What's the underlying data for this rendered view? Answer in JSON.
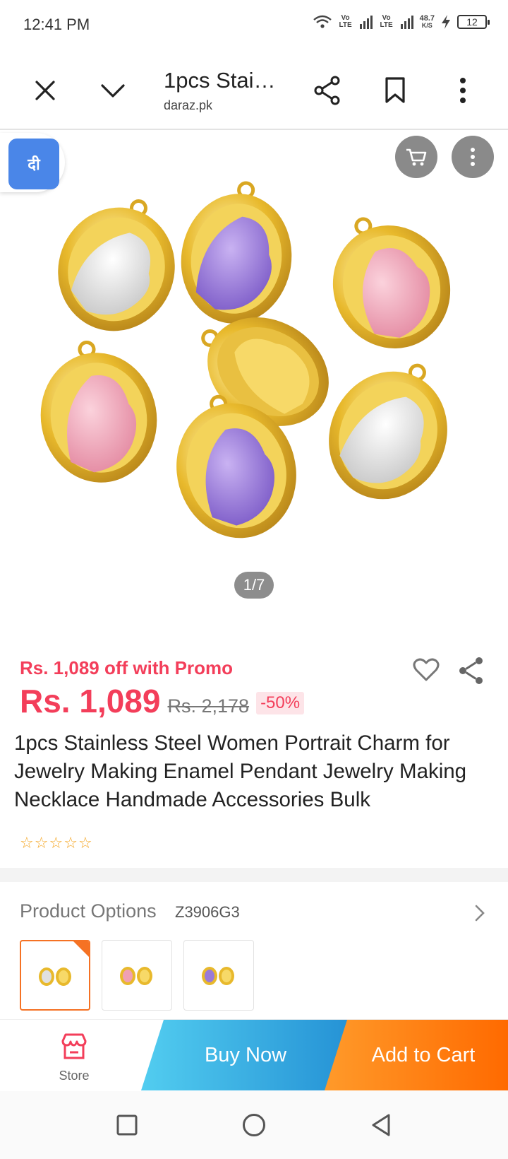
{
  "status_bar": {
    "time": "12:41 PM",
    "lte1": "Vo LTE",
    "lte2": "Vo LTE",
    "speed_value": "48.7",
    "speed_unit": "K/S",
    "battery": "12"
  },
  "toolbar": {
    "title": "1pcs Stai…",
    "domain": "daraz.pk"
  },
  "translate": {
    "badge_text": "दी"
  },
  "gallery": {
    "counter": "1/7"
  },
  "product": {
    "promo": "Rs. 1,089 off with Promo",
    "price": "Rs. 1,089",
    "original_price": "Rs. 2,178",
    "discount": "-50%",
    "title": "1pcs Stainless Steel Women Portrait Charm for Jewelry Making Enamel Pendant Jewelry Making Necklace Handmade Accessories Bulk",
    "stars": [
      "☆",
      "☆",
      "☆",
      "☆",
      "☆"
    ]
  },
  "options": {
    "label": "Product Options",
    "value": "Z3906G3"
  },
  "actions": {
    "store": "Store",
    "buy_now": "Buy Now",
    "add_to_cart": "Add to Cart"
  },
  "colors": {
    "accent_red": "#f33e5a",
    "orange": "#f57224",
    "buy_blue": "#2592d5",
    "gold": "#e6b422",
    "purple": "#9a7ad8",
    "pink": "#f0a0b4",
    "silver": "#e0e0e0"
  }
}
